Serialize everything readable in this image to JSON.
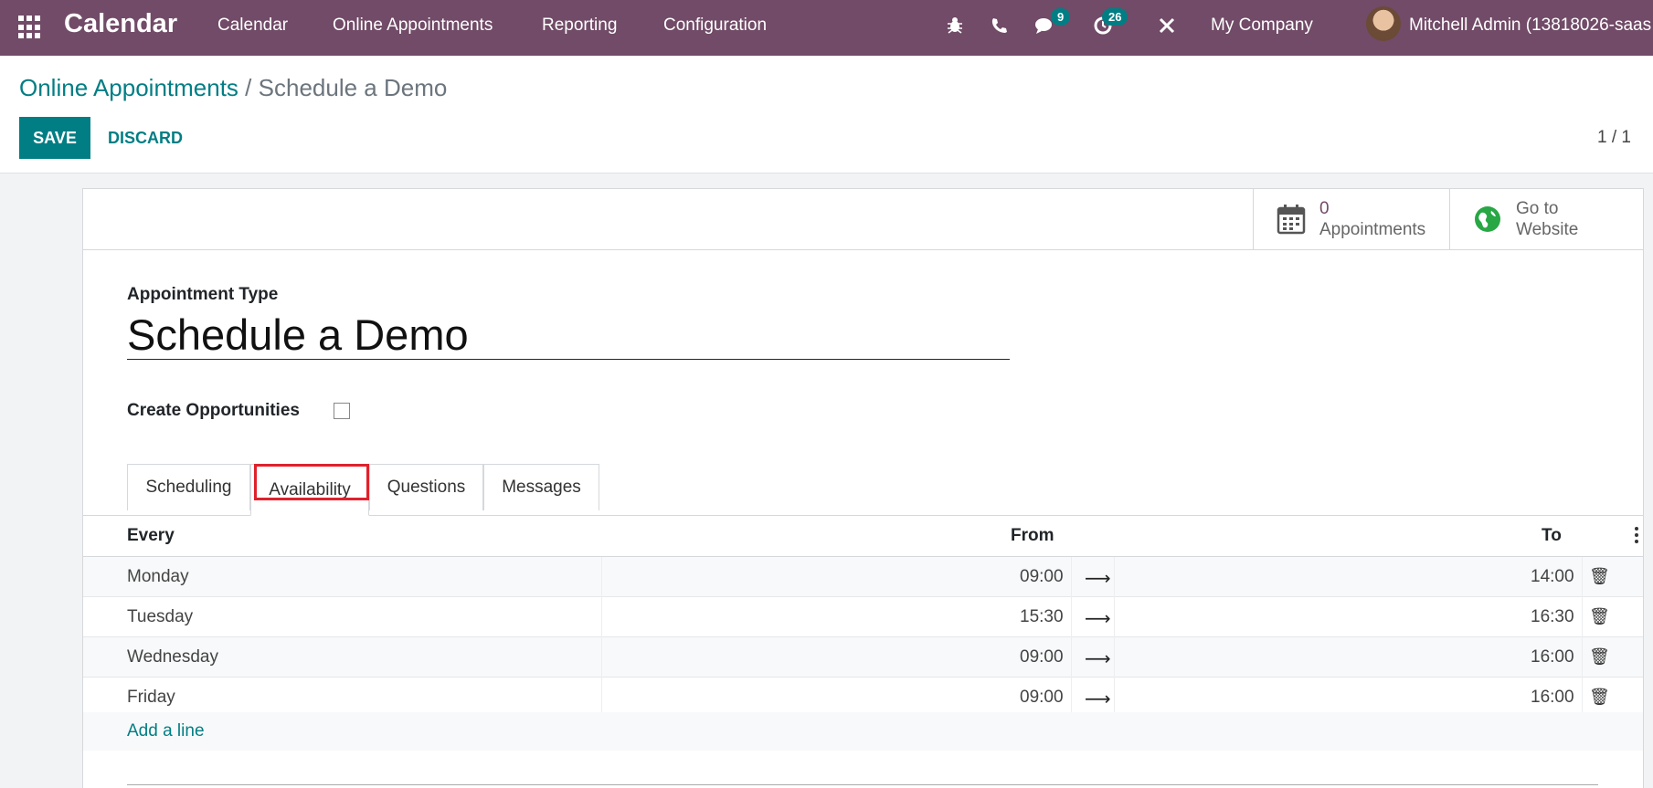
{
  "navbar": {
    "brand": "Calendar",
    "menu": [
      "Calendar",
      "Online Appointments",
      "Reporting",
      "Configuration"
    ],
    "messages_badge": "9",
    "activities_badge": "26",
    "company": "My Company",
    "user": "Mitchell Admin (13818026-saas"
  },
  "breadcrumb": {
    "parent": "Online Appointments",
    "separator": "/",
    "current": "Schedule a Demo"
  },
  "actions": {
    "save_label": "SAVE",
    "discard_label": "DISCARD",
    "pager": "1 / 1"
  },
  "stat_buttons": {
    "appointments_count": "0",
    "appointments_label": "Appointments",
    "website_line1": "Go to",
    "website_line2": "Website"
  },
  "form": {
    "appointment_type_label": "Appointment Type",
    "appointment_type_value": "Schedule a Demo",
    "create_opportunities_label": "Create Opportunities",
    "create_opportunities_checked": false
  },
  "tabs": [
    {
      "label": "Scheduling",
      "active": false
    },
    {
      "label": "Availability",
      "active": true
    },
    {
      "label": "Questions",
      "active": false
    },
    {
      "label": "Messages",
      "active": false
    }
  ],
  "table": {
    "headers": {
      "every": "Every",
      "from": "From",
      "to": "To"
    },
    "rows": [
      {
        "day": "Monday",
        "from": "09:00",
        "to": "14:00"
      },
      {
        "day": "Tuesday",
        "from": "15:30",
        "to": "16:30"
      },
      {
        "day": "Wednesday",
        "from": "09:00",
        "to": "16:00"
      },
      {
        "day": "Friday",
        "from": "09:00",
        "to": "16:00"
      }
    ],
    "add_line": "Add a line"
  },
  "colors": {
    "brand": "#714b67",
    "primary": "#017e84",
    "highlight": "#e0202c"
  }
}
